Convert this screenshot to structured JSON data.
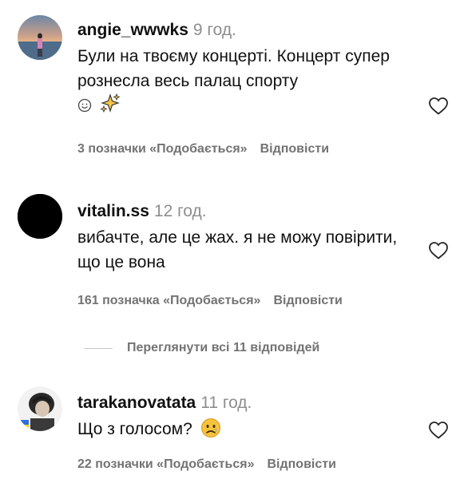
{
  "comments": [
    {
      "username": "angie_wwwks",
      "time": "9 год.",
      "text": "Були на твоєму концерті. Концерт супер рознесла весь палац спорту",
      "emoji": "☺✨",
      "likes": "3 позначки «Подобається»",
      "reply": "Відповісти"
    },
    {
      "username": "vitalin.ss",
      "time": "12 год.",
      "text": "вибачте, але це жах. я не можу повірити, що це вона",
      "likes": "161 позначка «Подобається»",
      "reply": "Відповісти"
    },
    {
      "username": "tarakanovatata",
      "time": "11 год.",
      "text": "Що з голосом?",
      "likes": "22 позначки «Подобається»",
      "reply": "Відповісти"
    }
  ],
  "view_replies": "Переглянути всі 11 відповідей",
  "colors": {
    "text": "#111111",
    "muted": "#737373",
    "time": "#8e8e8e",
    "heart_stroke": "#262626"
  },
  "icons": [
    "heart-icon",
    "smile-emoji-icon",
    "sparkles-emoji-icon",
    "sad-face-emoji-icon"
  ]
}
